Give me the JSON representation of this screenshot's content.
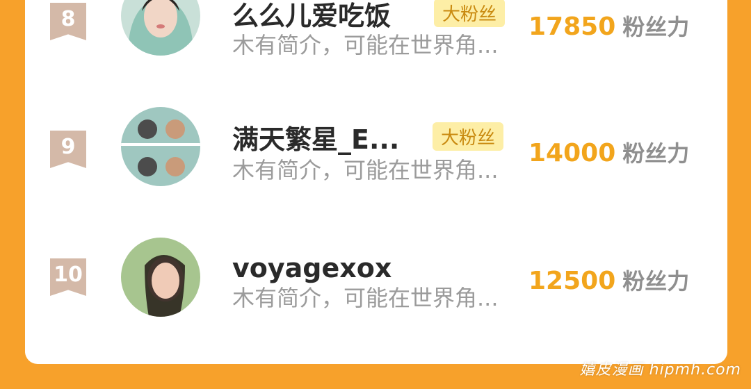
{
  "rows": [
    {
      "rank": "8",
      "name": "么么儿爱吃饭",
      "badge": "大粉丝",
      "bio": "木有简介，可能在世界角...",
      "fans": "17850",
      "unit": "粉丝力"
    },
    {
      "rank": "9",
      "name": "满天繁星_E...",
      "badge": "大粉丝",
      "bio": "木有简介，可能在世界角...",
      "fans": "14000",
      "unit": "粉丝力"
    },
    {
      "rank": "10",
      "name": "voyagexox",
      "badge": "",
      "bio": "木有简介，可能在世界角...",
      "fans": "12500",
      "unit": "粉丝力"
    }
  ],
  "watermark": "嬉皮漫画 hipmh.com",
  "colors": {
    "background": "#f7a12b",
    "fans_number": "#f2a51c",
    "badge_bg": "#fdeea6",
    "rank_badge": "#d4b9a8"
  }
}
